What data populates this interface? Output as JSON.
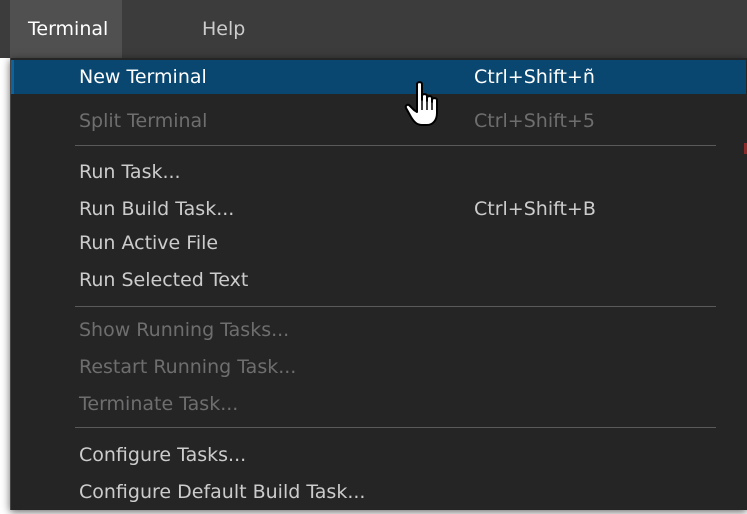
{
  "menubar": {
    "items": [
      {
        "label": "Terminal",
        "active": true
      },
      {
        "label": "Help",
        "active": false
      }
    ]
  },
  "menu": {
    "items": [
      {
        "label": "New Terminal",
        "shortcut": "Ctrl+Shift+ñ",
        "enabled": true,
        "selected": true
      },
      {
        "label": "Split Terminal",
        "shortcut": "Ctrl+Shift+5",
        "enabled": false
      },
      {
        "label": "Run Task...",
        "shortcut": "",
        "enabled": true
      },
      {
        "label": "Run Build Task...",
        "shortcut": "Ctrl+Shift+B",
        "enabled": true
      },
      {
        "label": "Run Active File",
        "shortcut": "",
        "enabled": true
      },
      {
        "label": "Run Selected Text",
        "shortcut": "",
        "enabled": true
      },
      {
        "label": "Show Running Tasks...",
        "shortcut": "",
        "enabled": false
      },
      {
        "label": "Restart Running Task...",
        "shortcut": "",
        "enabled": false
      },
      {
        "label": "Terminate Task...",
        "shortcut": "",
        "enabled": false
      },
      {
        "label": "Configure Tasks...",
        "shortcut": "",
        "enabled": true
      },
      {
        "label": "Configure Default Build Task...",
        "shortcut": "",
        "enabled": true
      }
    ]
  },
  "colors": {
    "menubar_bg": "#3c3c3c",
    "menu_bg": "#252526",
    "selection_bg": "#094771",
    "text": "#cccccc",
    "disabled_text": "#6e6e6e"
  },
  "icons": {
    "cursor": "hand-pointer-icon"
  }
}
